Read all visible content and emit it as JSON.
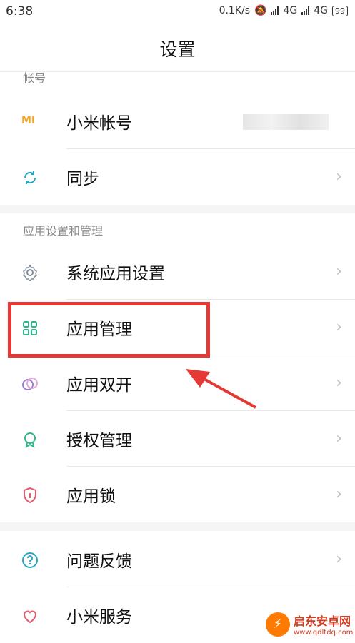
{
  "status_bar": {
    "time": "6:38",
    "net_speed": "0.1K/s",
    "network_1": "4G",
    "network_2": "4G",
    "battery": "99"
  },
  "header": {
    "title": "设置"
  },
  "sections": {
    "account_label": "帐号",
    "apps_label": "应用设置和管理"
  },
  "items": {
    "mi_account": {
      "label": "小米帐号",
      "icon_text": "MI"
    },
    "sync": {
      "label": "同步"
    },
    "system_apps": {
      "label": "系统应用设置"
    },
    "app_management": {
      "label": "应用管理"
    },
    "dual_apps": {
      "label": "应用双开"
    },
    "permissions": {
      "label": "授权管理"
    },
    "app_lock": {
      "label": "应用锁"
    },
    "feedback": {
      "label": "问题反馈"
    },
    "mi_service": {
      "label": "小米服务"
    }
  },
  "chevron": "›",
  "watermark": {
    "logo": "⚡",
    "name": "启东安卓网",
    "url": "www.qdltdq.com"
  },
  "colors": {
    "accent_red": "#e53935",
    "mi_orange": "#f5a623"
  }
}
